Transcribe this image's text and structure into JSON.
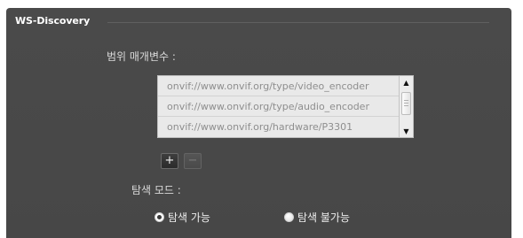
{
  "section": {
    "title": "WS-Discovery"
  },
  "scope": {
    "label": "범위 매개변수 :",
    "items": [
      "onvif://www.onvif.org/type/video_encoder",
      "onvif://www.onvif.org/type/audio_encoder",
      "onvif://www.onvif.org/hardware/P3301"
    ],
    "add_label": "+",
    "remove_label": "−"
  },
  "discovery_mode": {
    "label": "탐색 모드 :",
    "options": [
      {
        "label": "탐색 가능",
        "selected": true
      },
      {
        "label": "탐색 불가능",
        "selected": false
      }
    ]
  },
  "colors": {
    "panel_bg": "#4a4a4a",
    "list_bg": "#e9e9e9",
    "text_light": "#d9d9d9"
  },
  "icons": {
    "scroll_up": "up-arrow-icon",
    "scroll_down": "down-arrow-icon",
    "add": "plus-icon",
    "remove": "minus-icon"
  }
}
